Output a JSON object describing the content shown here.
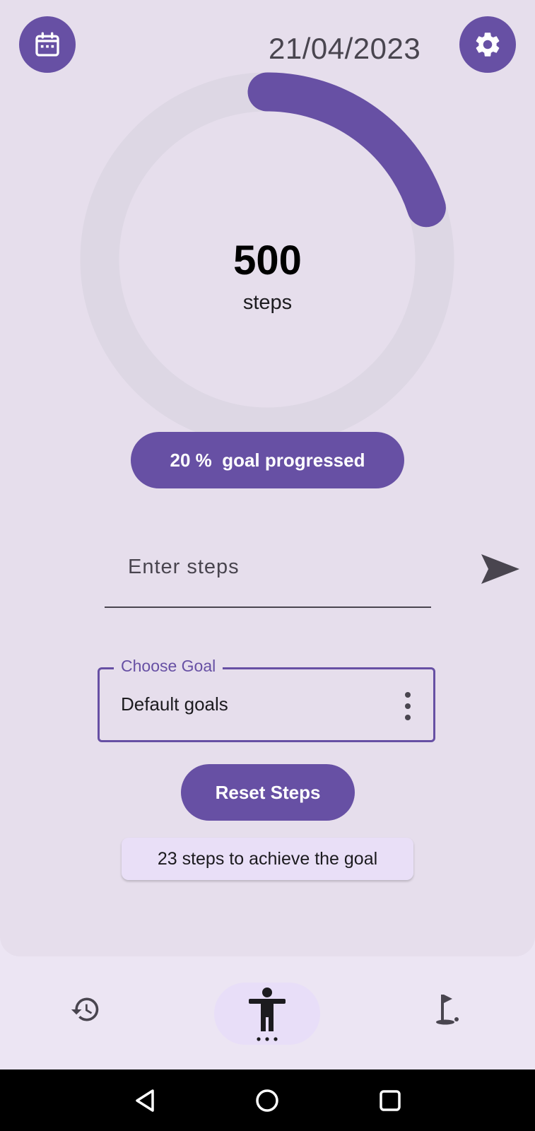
{
  "header": {
    "calendar_icon": "calendar-icon",
    "date": "21/04/2023",
    "settings_icon": "gear-icon"
  },
  "progress_ring": {
    "steps": "500",
    "unit": "steps",
    "fill_fraction": 0.2,
    "track_color": "#ddd7e4",
    "fill_color": "#6750a4"
  },
  "goal_progress_label": "20 %  goal progressed",
  "steps_input": {
    "value": "",
    "placeholder": "Enter steps",
    "send_icon": "send-icon"
  },
  "goal_select": {
    "legend": "Choose Goal",
    "selected": "Default goals",
    "menu_icon": "more-vert-icon"
  },
  "reset_button": "Reset Steps",
  "remaining_label": "23 steps to achieve the goal",
  "bottom_nav": {
    "items": [
      {
        "icon": "history-icon",
        "active": false
      },
      {
        "icon": "accessibility-icon",
        "active": true
      },
      {
        "icon": "golf-flag-icon",
        "active": false
      }
    ]
  },
  "system_nav": [
    "back-icon",
    "home-icon",
    "recents-icon"
  ],
  "colors": {
    "primary": "#6750a4",
    "surface": "#e6deec",
    "nav_background": "#ece5f3"
  }
}
